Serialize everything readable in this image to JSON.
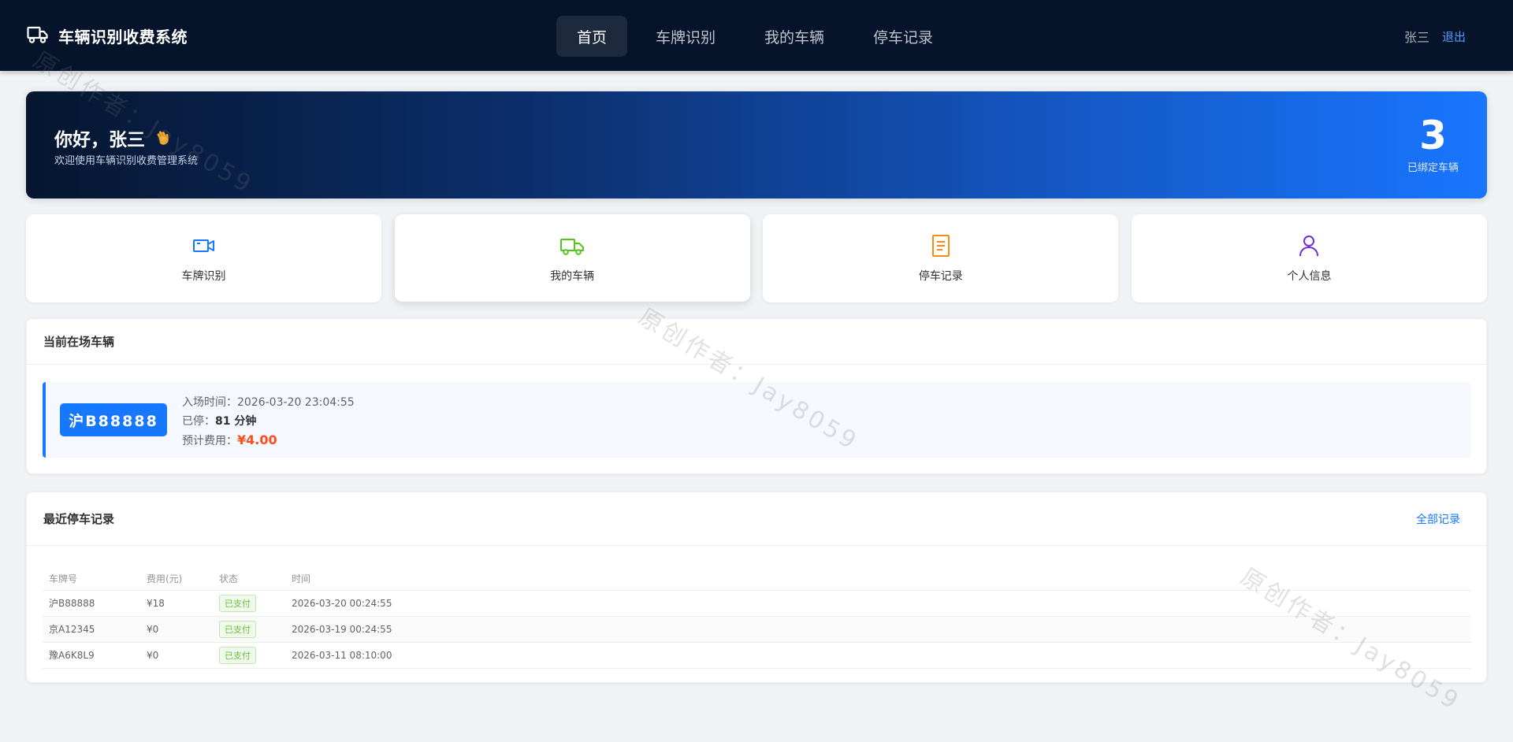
{
  "app": {
    "title": "车辆识别收费系统"
  },
  "nav": {
    "items": [
      {
        "label": "首页",
        "active": true
      },
      {
        "label": "车牌识别"
      },
      {
        "label": "我的车辆"
      },
      {
        "label": "停车记录"
      }
    ],
    "username": "张三",
    "logout_label": "退出"
  },
  "banner": {
    "greeting": "你好，张三",
    "subtitle": "欢迎使用车辆识别收费管理系统",
    "stat_value": "3",
    "stat_label": "已绑定车辆"
  },
  "quick_cards": [
    {
      "label": "车牌识别",
      "icon": "camera-icon",
      "color": "#1677ff"
    },
    {
      "label": "我的车辆",
      "icon": "truck-icon",
      "color": "#52c41a"
    },
    {
      "label": "停车记录",
      "icon": "document-icon",
      "color": "#fa8c16"
    },
    {
      "label": "个人信息",
      "icon": "user-icon",
      "color": "#722ed1"
    }
  ],
  "current": {
    "title": "当前在场车辆",
    "plate": "沪B88888",
    "entry_label": "入场时间：",
    "entry_time": "2026-03-20 23:04:55",
    "duration_label": "已停：",
    "duration": "81 分钟",
    "fee_label": "预计费用：",
    "fee": "¥4.00"
  },
  "recent": {
    "title": "最近停车记录",
    "all_link": "全部记录",
    "columns": [
      "车牌号",
      "费用(元)",
      "状态",
      "时间"
    ],
    "rows": [
      {
        "plate": "沪B88888",
        "fee": "¥18",
        "status": "已支付",
        "time": "2026-03-20 00:24:55"
      },
      {
        "plate": "京A12345",
        "fee": "¥0",
        "status": "已支付",
        "time": "2026-03-19 00:24:55"
      },
      {
        "plate": "豫A6K8L9",
        "fee": "¥0",
        "status": "已支付",
        "time": "2026-03-11 08:10:00"
      }
    ]
  },
  "watermark": "原创作者：Jay8059"
}
